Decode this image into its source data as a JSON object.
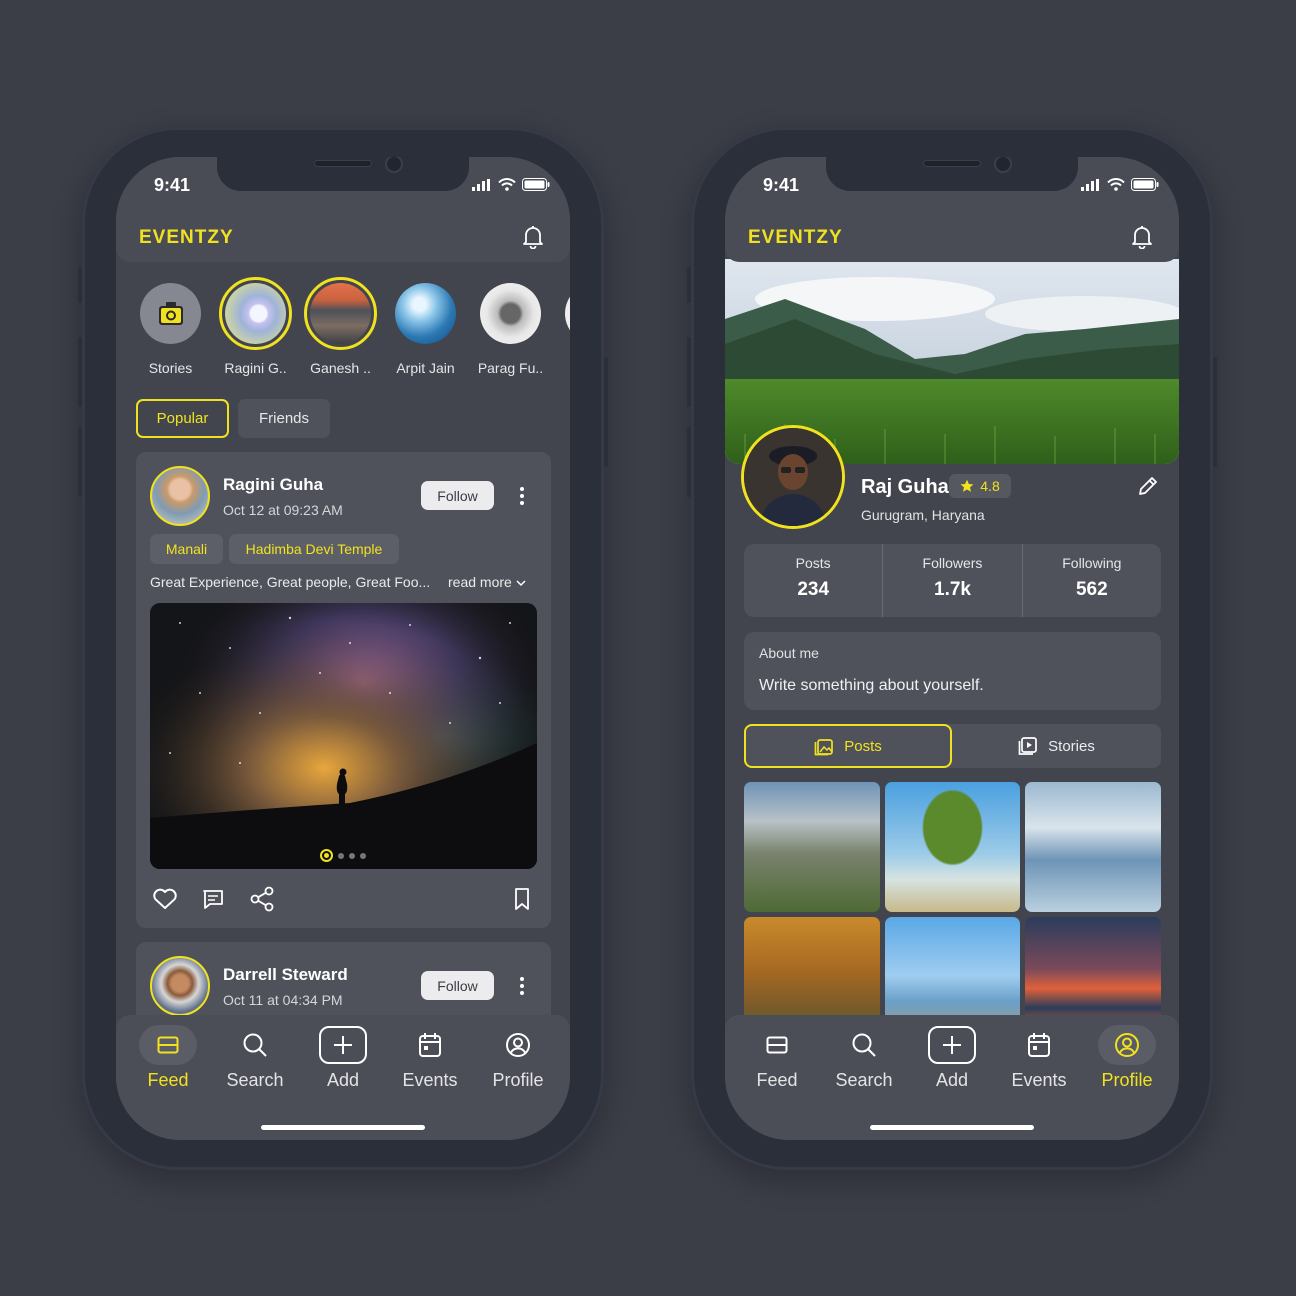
{
  "colors": {
    "accent": "#f1e21f",
    "background": "#3b3d47",
    "card": "#50525b"
  },
  "status": {
    "time": "9:41"
  },
  "app": {
    "name": "EVENTZY"
  },
  "feed": {
    "stories": [
      {
        "name": "Stories",
        "icon": "camera-icon"
      },
      {
        "name": "Ragini G.."
      },
      {
        "name": "Ganesh .."
      },
      {
        "name": "Arpit Jain"
      },
      {
        "name": "Parag Fu.."
      }
    ],
    "filters": {
      "popular": "Popular",
      "friends": "Friends"
    },
    "posts": [
      {
        "author": "Ragini Guha",
        "date": "Oct 12 at 09:23 AM",
        "follow": "Follow",
        "tags": [
          "Manali",
          "Hadimba Devi Temple"
        ],
        "caption": "Great Experience, Great people, Great Foo...",
        "read_more": "read more",
        "carousel_index": 1,
        "carousel_count": 4
      },
      {
        "author": "Darrell Steward",
        "date": "Oct 11 at 04:34 PM",
        "follow": "Follow"
      }
    ]
  },
  "nav": {
    "feed": "Feed",
    "search": "Search",
    "add": "Add",
    "events": "Events",
    "profile": "Profile"
  },
  "profile": {
    "name": "Raj Guha",
    "rating": "4.8",
    "location": "Gurugram, Haryana",
    "stats": [
      {
        "label": "Posts",
        "value": "234"
      },
      {
        "label": "Followers",
        "value": "1.7k"
      },
      {
        "label": "Following",
        "value": "562"
      }
    ],
    "about_title": "About me",
    "about_text": "Write something about yourself.",
    "tabs": {
      "posts": "Posts",
      "stories": "Stories"
    }
  }
}
